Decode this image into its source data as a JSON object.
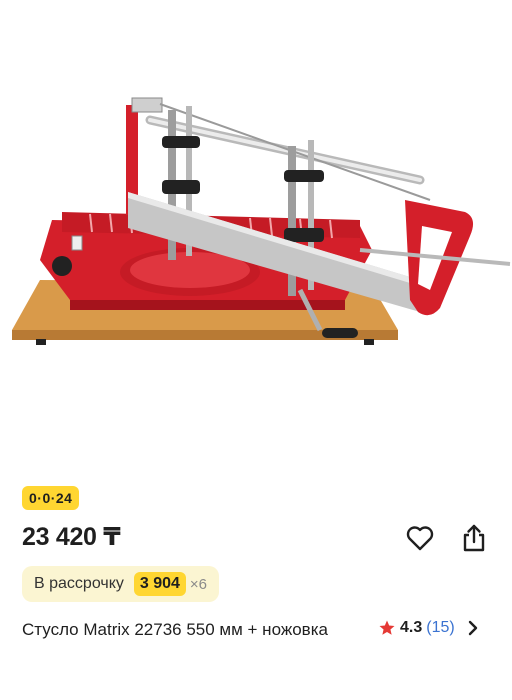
{
  "product": {
    "badge": "0·0·24",
    "price": "23 420 ₸",
    "installment": {
      "label": "В рассрочку",
      "amount": "3 904",
      "multiplier": "×6"
    },
    "title": "Стусло Matrix 22736 550 мм + ножовка",
    "rating": {
      "score": "4.3",
      "count": "(15)"
    }
  },
  "icons": {
    "favorite": "heart-icon",
    "share": "share-icon",
    "star": "star-icon",
    "more": "chevron-right-icon"
  },
  "colors": {
    "badge": "#ffd631",
    "installment_bg": "#fbf5d2",
    "accent_red": "#d41f2a",
    "rating_count": "#3b73d1",
    "star": "#e53935"
  }
}
